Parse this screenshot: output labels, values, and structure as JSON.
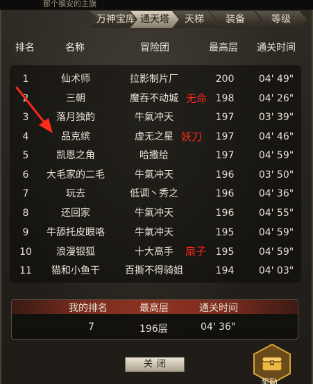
{
  "topbar": {
    "text": "那个猴安的主旗"
  },
  "tabs": [
    {
      "label": "万神宝库",
      "active": false
    },
    {
      "label": "通天塔",
      "active": true
    },
    {
      "label": "天梯",
      "active": false
    },
    {
      "label": "装备",
      "active": false
    },
    {
      "label": "等级",
      "active": false
    }
  ],
  "columns": {
    "rank": "排名",
    "name": "名称",
    "guild": "冒险团",
    "floor": "最高层",
    "time": "通关时间"
  },
  "rows": [
    {
      "rank": "1",
      "name": "仙术师",
      "guild": "拉影制片厂",
      "floor": "200",
      "time": "04' 49\""
    },
    {
      "rank": "2",
      "name": "三朝",
      "guild": "魔吞不动城",
      "floor": "198",
      "time": "04' 26\""
    },
    {
      "rank": "3",
      "name": "落月独酌",
      "guild": "牛氣冲天",
      "floor": "197",
      "time": "03' 39\""
    },
    {
      "rank": "4",
      "name": "品克缤",
      "guild": "虚无之星",
      "floor": "197",
      "time": "04' 46\""
    },
    {
      "rank": "5",
      "name": "凯恩之角",
      "guild": "哈撒给",
      "floor": "197",
      "time": "04' 59\""
    },
    {
      "rank": "6",
      "name": "大毛家的二毛",
      "guild": "牛氣冲天",
      "floor": "196",
      "time": "03' 50\""
    },
    {
      "rank": "7",
      "name": "玩去",
      "guild": "低调丶秀之",
      "floor": "196",
      "time": "04' 36\""
    },
    {
      "rank": "8",
      "name": "还回家",
      "guild": "牛氣冲天",
      "floor": "196",
      "time": "04' 55\""
    },
    {
      "rank": "9",
      "name": "牛舔托皮眼咯",
      "guild": "牛氣冲天",
      "floor": "195",
      "time": "04' 59\""
    },
    {
      "rank": "10",
      "name": "浪漫银狐",
      "guild": "十大高手",
      "floor": "195",
      "time": "04' 59\""
    },
    {
      "rank": "11",
      "name": "猫和小鱼干",
      "guild": "百撕不得骑姐",
      "floor": "194",
      "time": "04' 03\""
    }
  ],
  "annotations": {
    "row2": "无命",
    "row4": "妖刀",
    "row10": "扇子"
  },
  "my_rank": {
    "header_rank": "我的排名",
    "header_floor": "最高层",
    "header_time": "通关时间",
    "rank": "7",
    "floor": "196层",
    "time": "04' 36\""
  },
  "close_label": "关闭",
  "reward_label": "奖励",
  "colors": {
    "annotation": "#ff2a1a",
    "active_tab": "#c8c0ad"
  }
}
